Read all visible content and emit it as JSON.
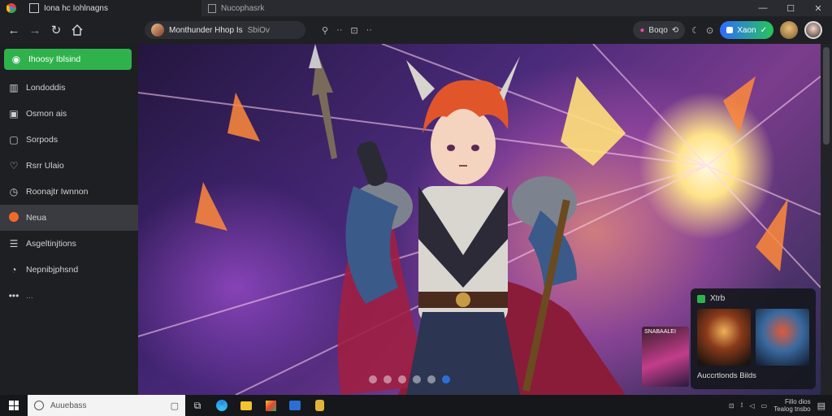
{
  "browser": {
    "active_tab_title": "Iona hc Iohlnagns",
    "inactive_tab_title": "Nucophasrk",
    "address_text": "Monthunder Hhop Is",
    "address_suffix": "SbiOv",
    "account_pill": "Boqo",
    "grad_pill": "Xaon"
  },
  "sidebar": {
    "items": [
      {
        "label": "Ihoosy Iblsind",
        "icon": "home-icon"
      },
      {
        "label": "Londoddis",
        "icon": "library-icon"
      },
      {
        "label": "Osmon ais",
        "icon": "grid-icon"
      },
      {
        "label": "Sorpods",
        "icon": "folder-icon"
      },
      {
        "label": "Rsrr Ulaio",
        "icon": "heart-icon"
      },
      {
        "label": "Roonajtr Iwnnon",
        "icon": "clock-icon"
      },
      {
        "label": "Neua",
        "icon": "orange-dot-icon"
      },
      {
        "label": "Asgeltinjtions",
        "icon": "list-icon"
      },
      {
        "label": "Nepnibjphsnd",
        "icon": "chat-icon"
      },
      {
        "label": "...",
        "icon": "more-icon"
      }
    ]
  },
  "carousel": {
    "active_index": 5,
    "count": 6
  },
  "panel": {
    "header": "Xtrb",
    "footer": "Auccrtlonds Bilds"
  },
  "promo": {
    "label": "SNABAALEI"
  },
  "taskbar": {
    "search_placeholder": "Auuebass",
    "clock_time": "Fillo dios",
    "clock_date": "Tealog tnsbo"
  }
}
